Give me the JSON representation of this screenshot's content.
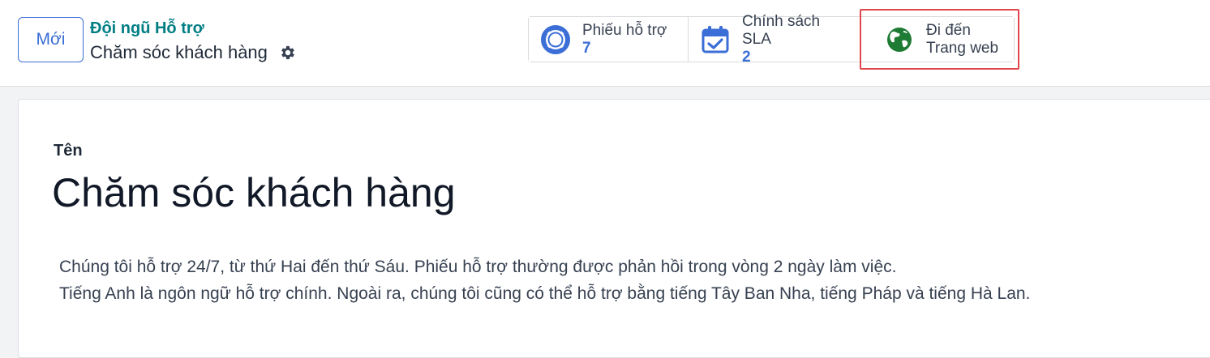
{
  "control_panel": {
    "new_button": "Mới",
    "breadcrumb_parent": "Đội ngũ Hỗ trợ",
    "record_title": "Chăm sóc khách hàng"
  },
  "smart_buttons": {
    "tickets": {
      "label": "Phiếu hỗ trợ",
      "value": "7"
    },
    "sla": {
      "label": "Chính sách SLA",
      "value": "2"
    },
    "website": {
      "label": "Đi đến",
      "sub": "Trang web"
    }
  },
  "form": {
    "name_label": "Tên",
    "name_value": "Chăm sóc khách hàng",
    "description_lines": [
      "Chúng tôi hỗ trợ 24/7, từ thứ Hai đến thứ Sáu. Phiếu hỗ trợ thường được phản hồi trong vòng 2 ngày làm việc.",
      "Tiếng Anh là ngôn ngữ hỗ trợ chính. Ngoài ra, chúng tôi cũng có thể hỗ trợ bằng tiếng Tây Ban Nha, tiếng Pháp và tiếng Hà Lan."
    ]
  },
  "colors": {
    "accent": "#3b6ed6",
    "breadcrumb": "#017e84",
    "globe": "#1e7b34",
    "highlight": "#e0474c"
  },
  "icons": {
    "tickets": "life-ring-icon",
    "sla": "calendar-check-icon",
    "website": "globe-icon",
    "settings": "gear-icon"
  }
}
